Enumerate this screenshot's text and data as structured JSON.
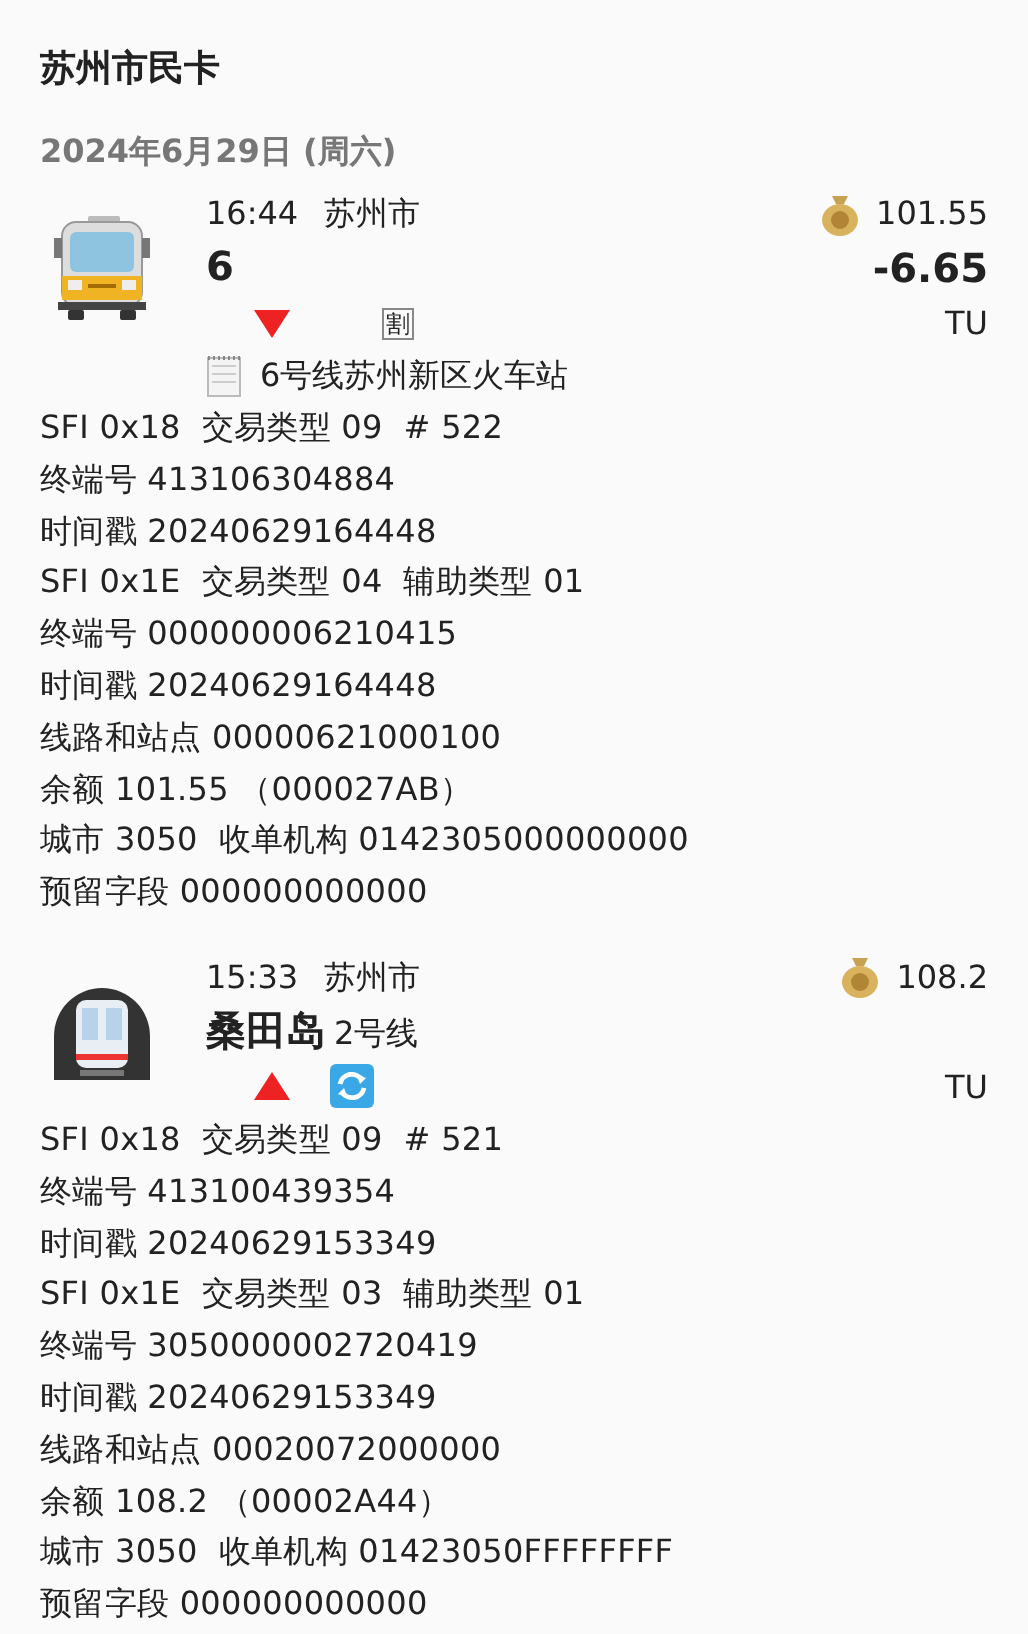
{
  "title": "苏州市民卡",
  "date": "2024年6月29日 (周六)",
  "trips": [
    {
      "kind": "bus",
      "time": "16:44",
      "city": "苏州市",
      "title": "6",
      "balance": "101.55",
      "amount": "-6.65",
      "unit": "TU",
      "badges": [
        {
          "kind": "down"
        },
        {
          "kind": "text",
          "text": "割"
        }
      ],
      "note": "6号线苏州新区火车站",
      "details": [
        "SFI 0x18  交易类型 09  # 522",
        "终端号 413106304884",
        "时间戳 20240629164448",
        "SFI 0x1E  交易类型 04  辅助类型 01",
        "终端号 000000006210415",
        "时间戳 20240629164448",
        "线路和站点 00000621000100",
        "余额 101.55 （000027AB）",
        "城市 3050  收单机构 0142305000000000",
        "预留字段 000000000000"
      ]
    },
    {
      "kind": "metro",
      "time": "15:33",
      "city": "苏州市",
      "title": "桑田岛",
      "subtitle": "2号线",
      "balance": "108.2",
      "unit": "TU",
      "badges": [
        {
          "kind": "up"
        },
        {
          "kind": "transfer"
        }
      ],
      "details": [
        "SFI 0x18  交易类型 09  # 521",
        "终端号 413100439354",
        "时间戳 20240629153349",
        "SFI 0x1E  交易类型 03  辅助类型 01",
        "终端号 3050000002720419",
        "时间戳 20240629153349",
        "线路和站点 00020072000000",
        "余额 108.2 （00002A44）",
        "城市 3050  收单机构 01423050FFFFFFFF",
        "预留字段 000000000000"
      ]
    }
  ]
}
